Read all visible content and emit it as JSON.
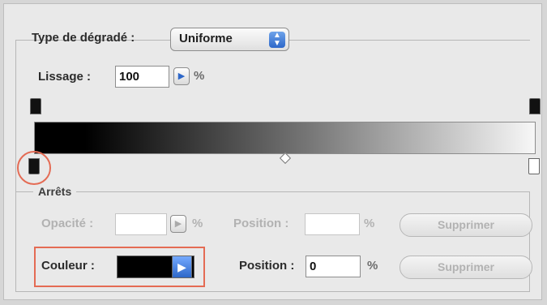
{
  "gradient": {
    "type_label": "Type de dégradé :",
    "type_value": "Uniforme",
    "smoothness_label": "Lissage :",
    "smoothness_value": "100",
    "smoothness_unit": "%"
  },
  "stops": {
    "title": "Arrêts",
    "opacity_label": "Opacité :",
    "opacity_value": "",
    "opacity_unit": "%",
    "opacity_position_label": "Position :",
    "opacity_position_value": "",
    "opacity_position_unit": "%",
    "opacity_delete": "Supprimer",
    "color_label": "Couleur :",
    "color_value": "#000000",
    "color_position_label": "Position :",
    "color_position_value": "0",
    "color_position_unit": "%",
    "color_delete": "Supprimer"
  },
  "colors": {
    "highlight": "#e46b54",
    "accent_blue": "#2d67c9"
  },
  "icons": {
    "stepper": "triangle-right-icon",
    "dropdown": "updown-arrows-icon"
  }
}
